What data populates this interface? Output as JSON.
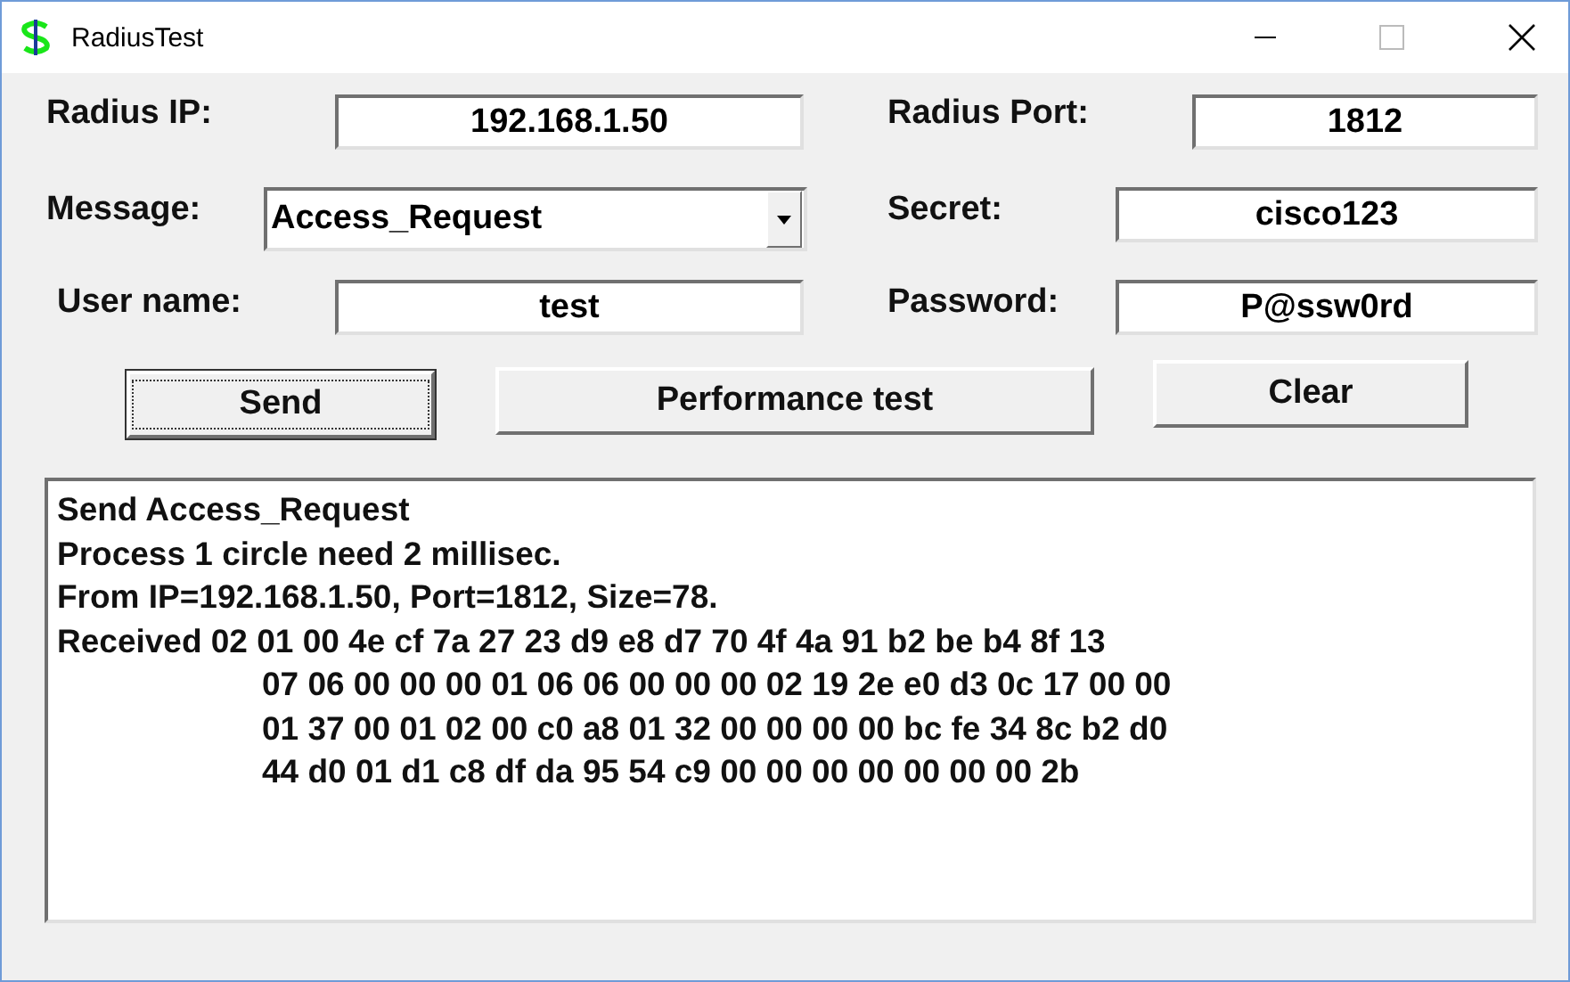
{
  "window": {
    "title": "RadiusTest"
  },
  "fields": [
    {
      "label": "Radius IP:",
      "value": "192.168.1.50",
      "kind": "text"
    },
    {
      "label": "Radius Port:",
      "value": "1812",
      "kind": "text"
    },
    {
      "label": "Message:",
      "value": "Access_Request",
      "kind": "combo"
    },
    {
      "label": "Secret:",
      "value": "cisco123",
      "kind": "text"
    },
    {
      "label": "User name:",
      "value": "test",
      "kind": "text"
    },
    {
      "label": "Password:",
      "value": "P@ssw0rd",
      "kind": "text"
    }
  ],
  "buttons": [
    {
      "label": "Send",
      "focused": true
    },
    {
      "label": "Performance test",
      "focused": false
    },
    {
      "label": "Clear",
      "focused": false
    }
  ],
  "log": [
    {
      "text": "Send Access_Request",
      "kind": "line"
    },
    {
      "text": "Process 1 circle need 2 millisec.",
      "kind": "line"
    },
    {
      "text": "From IP=192.168.1.50, Port=1812, Size=78.",
      "kind": "line"
    },
    {
      "text": "Received 02 01 00 4e cf 7a 27 23 d9 e8 d7 70 4f 4a 91 b2 be b4 8f 13",
      "kind": "line"
    },
    {
      "text": "07 06 00 00 00 01 06 06 00 00 00 02 19 2e e0 d3 0c 17 00 00",
      "kind": "continuation"
    },
    {
      "text": "01 37 00 01 02 00 c0 a8 01 32 00 00 00 00 bc fe 34 8c b2 d0",
      "kind": "continuation"
    },
    {
      "text": "44 d0 01 d1 c8 df da 95 54 c9 00 00 00 00 00 00 00 2b",
      "kind": "continuation"
    }
  ]
}
